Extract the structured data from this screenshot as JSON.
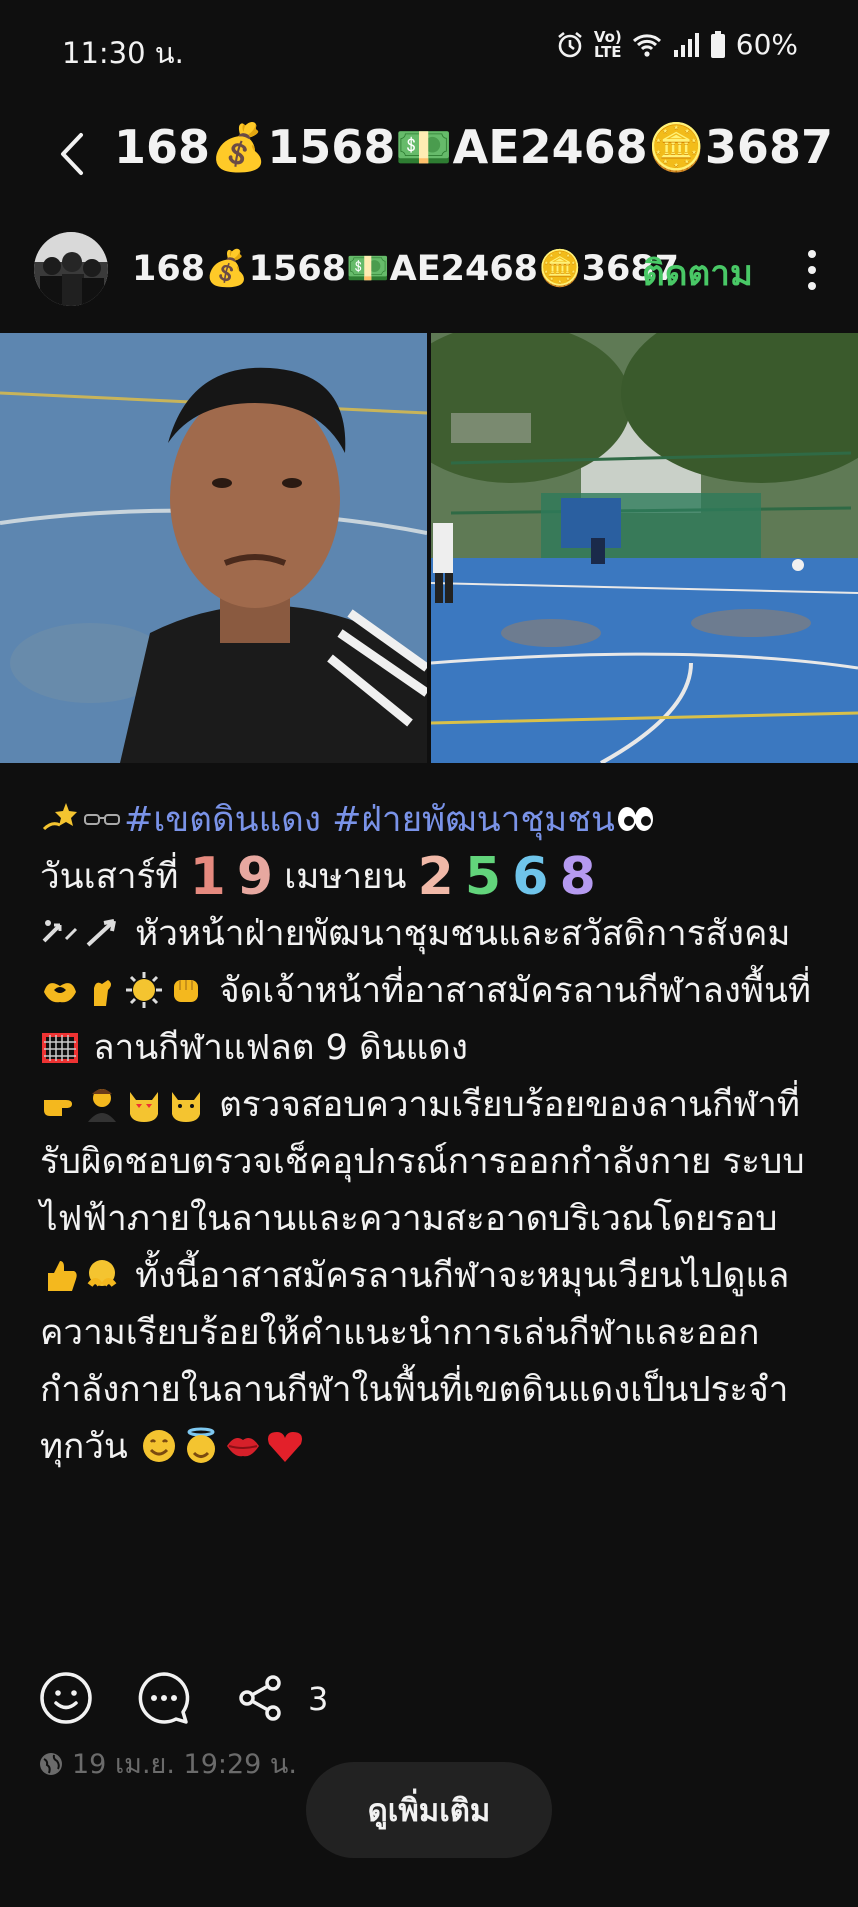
{
  "status_bar": {
    "time": "11:30 น.",
    "battery": "60%",
    "icons": [
      "alarm-icon",
      "volte-icon",
      "wifi-icon",
      "signal-icon",
      "battery-icon"
    ]
  },
  "header": {
    "title": "168💰1568💵AE2468🪙3687"
  },
  "author": {
    "name": "168💰1568💵AE2468🪙3687",
    "follow_label": "ติดตาม"
  },
  "post": {
    "tags": "#เขตดินแดง #ฝ่ายพัฒนาชุมชน",
    "date_prefix": "วันเสาร์ที่",
    "day_digits": [
      "1",
      "9"
    ],
    "month": "เมษายน",
    "year_digits": [
      "2",
      "5",
      "6",
      "8"
    ],
    "line_head": "หัวหน้าฝ่ายพัฒนาชุมชนและสวัสดิการสังคม",
    "line_staff": "จัดเจ้าหน้าที่อาสาสมัครลานกีฬาลงพื้นที่",
    "line_place": "ลานกีฬาแฟลต 9 ดินแดง",
    "line_check": "ตรวจสอบความเรียบร้อยของลานกีฬาที่รับผิดชอบตรวจเช็คอุปกรณ์การออกกำลังกาย ระบบไฟฟ้าภายในลานและความสะอาดบริเวณโดยรอบ",
    "line_rotate": "ทั้งนี้อาสาสมัครลานกีฬาจะหมุนเวียนไปดูแลความเรียบร้อยให้คำแนะนำการเล่นกีฬาและออกกำลังกายในลานกีฬาในพื้นที่เขตดินแดงเป็นประจำทุกวัน"
  },
  "actions": {
    "share_count": "3"
  },
  "timestamp": "19 เม.ย. 19:29 น.",
  "see_more_label": "ดูเพิ่มเติม",
  "colors": {
    "background": "#0f0f0f",
    "follow": "#49c866",
    "hashtag": "#7a93e8",
    "muted": "#6b6b6b"
  }
}
